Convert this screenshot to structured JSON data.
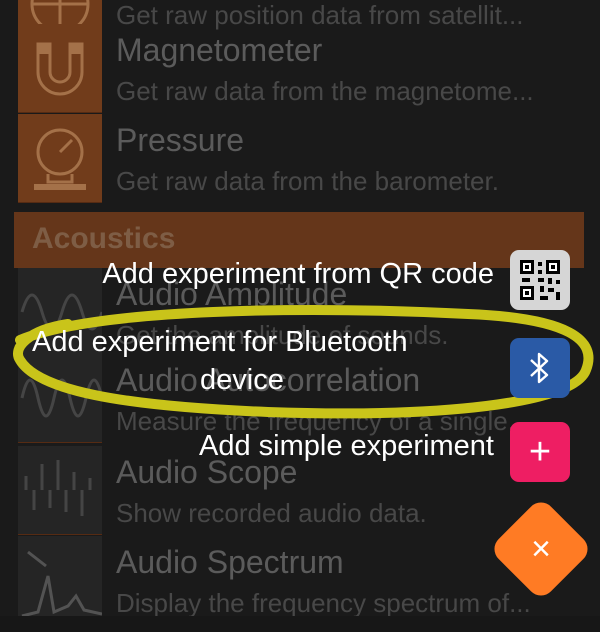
{
  "experiments": [
    {
      "title": "",
      "subtitle": "Get raw position data from satellit...",
      "icon": "satellite-icon"
    },
    {
      "title": "Magnetometer",
      "subtitle": "Get raw data from the magnetome...",
      "icon": "magnet-icon"
    },
    {
      "title": "Pressure",
      "subtitle": "Get raw data from the barometer.",
      "icon": "barometer-icon"
    }
  ],
  "category": "Acoustics",
  "acoustics": [
    {
      "title": "Audio Amplitude",
      "subtitle": "Get the amplitude of sounds.",
      "icon": "waveform-icon"
    },
    {
      "title": "Audio Autocorrelation",
      "subtitle": "Measure the frequency of a single...",
      "icon": "autocorrelation-icon"
    },
    {
      "title": "Audio Scope",
      "subtitle": "Show recorded audio data.",
      "icon": "scope-icon"
    },
    {
      "title": "Audio Spectrum",
      "subtitle": "Display the frequency spectrum of...",
      "icon": "spectrum-icon"
    }
  ],
  "fab_menu": {
    "qr_label": "Add experiment from QR code",
    "bluetooth_label_line1": "Add experiment for Bluetooth",
    "bluetooth_label_line2": "device",
    "simple_label": "Add simple experiment",
    "close_glyph": "×",
    "plus_glyph": "+"
  },
  "colors": {
    "accent": "#ff7b24",
    "bluetooth": "#2a5aa6",
    "simple": "#ee1e63",
    "qr_bg": "#d6d6d6",
    "highlight": "#c9c41a"
  }
}
